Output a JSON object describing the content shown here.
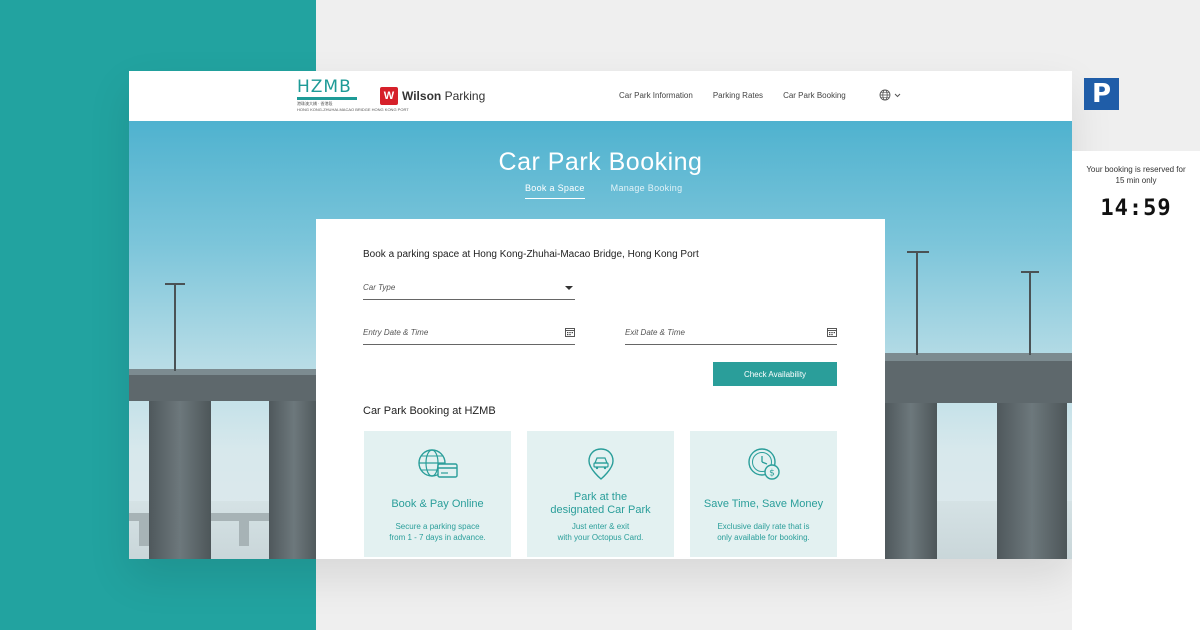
{
  "header": {
    "hzmb_logo_text": "HZMB",
    "hzmb_logo_subtext": "港珠澳大橋 · 香港段",
    "hzmb_logo_subtext2": "HONG KONG-ZHUHAI-MACAO BRIDGE HONG KONG PORT",
    "wilson_logo_mark": "W",
    "wilson_logo_bold": "Wilson",
    "wilson_logo_rest": " Parking",
    "nav": [
      {
        "label": "Car Park Information"
      },
      {
        "label": "Parking Rates"
      },
      {
        "label": "Car Park Booking"
      }
    ],
    "language_icon": "globe-icon"
  },
  "hero": {
    "title": "Car Park Booking",
    "tabs": [
      {
        "label": "Book a Space",
        "active": true
      },
      {
        "label": "Manage Booking",
        "active": false
      }
    ]
  },
  "form": {
    "heading": "Book a parking space at Hong Kong-Zhuhai-Macao Bridge, Hong Kong Port",
    "car_type_label": "Car Type",
    "entry_label": "Entry Date & Time",
    "exit_label": "Exit Date & Time",
    "check_button": "Check Availability"
  },
  "features": {
    "section_title": "Car Park Booking at HZMB",
    "items": [
      {
        "icon": "globe-card-icon",
        "title_line1": "Book & Pay Online",
        "title_line2": "",
        "desc_line1": "Secure a parking space",
        "desc_line2": "from 1 - 7 days in advance."
      },
      {
        "icon": "location-car-icon",
        "title_line1": "Park at the",
        "title_line2": "designated Car Park",
        "desc_line1": "Just enter & exit",
        "desc_line2": "with your Octopus Card."
      },
      {
        "icon": "clock-money-icon",
        "title_line1": "Save Time, Save Money",
        "title_line2": "",
        "desc_line1": "Exclusive daily rate that is",
        "desc_line2": "only available for booking."
      }
    ]
  },
  "side": {
    "p_logo": "P",
    "reserve_line1": "Your booking is reserved for",
    "reserve_line2": "15 min only",
    "timer": "14:59"
  },
  "colors": {
    "teal": "#22a3a0",
    "accent": "#2a9e9a",
    "wilson_red": "#d6202a",
    "parking_blue": "#1f5da8"
  }
}
